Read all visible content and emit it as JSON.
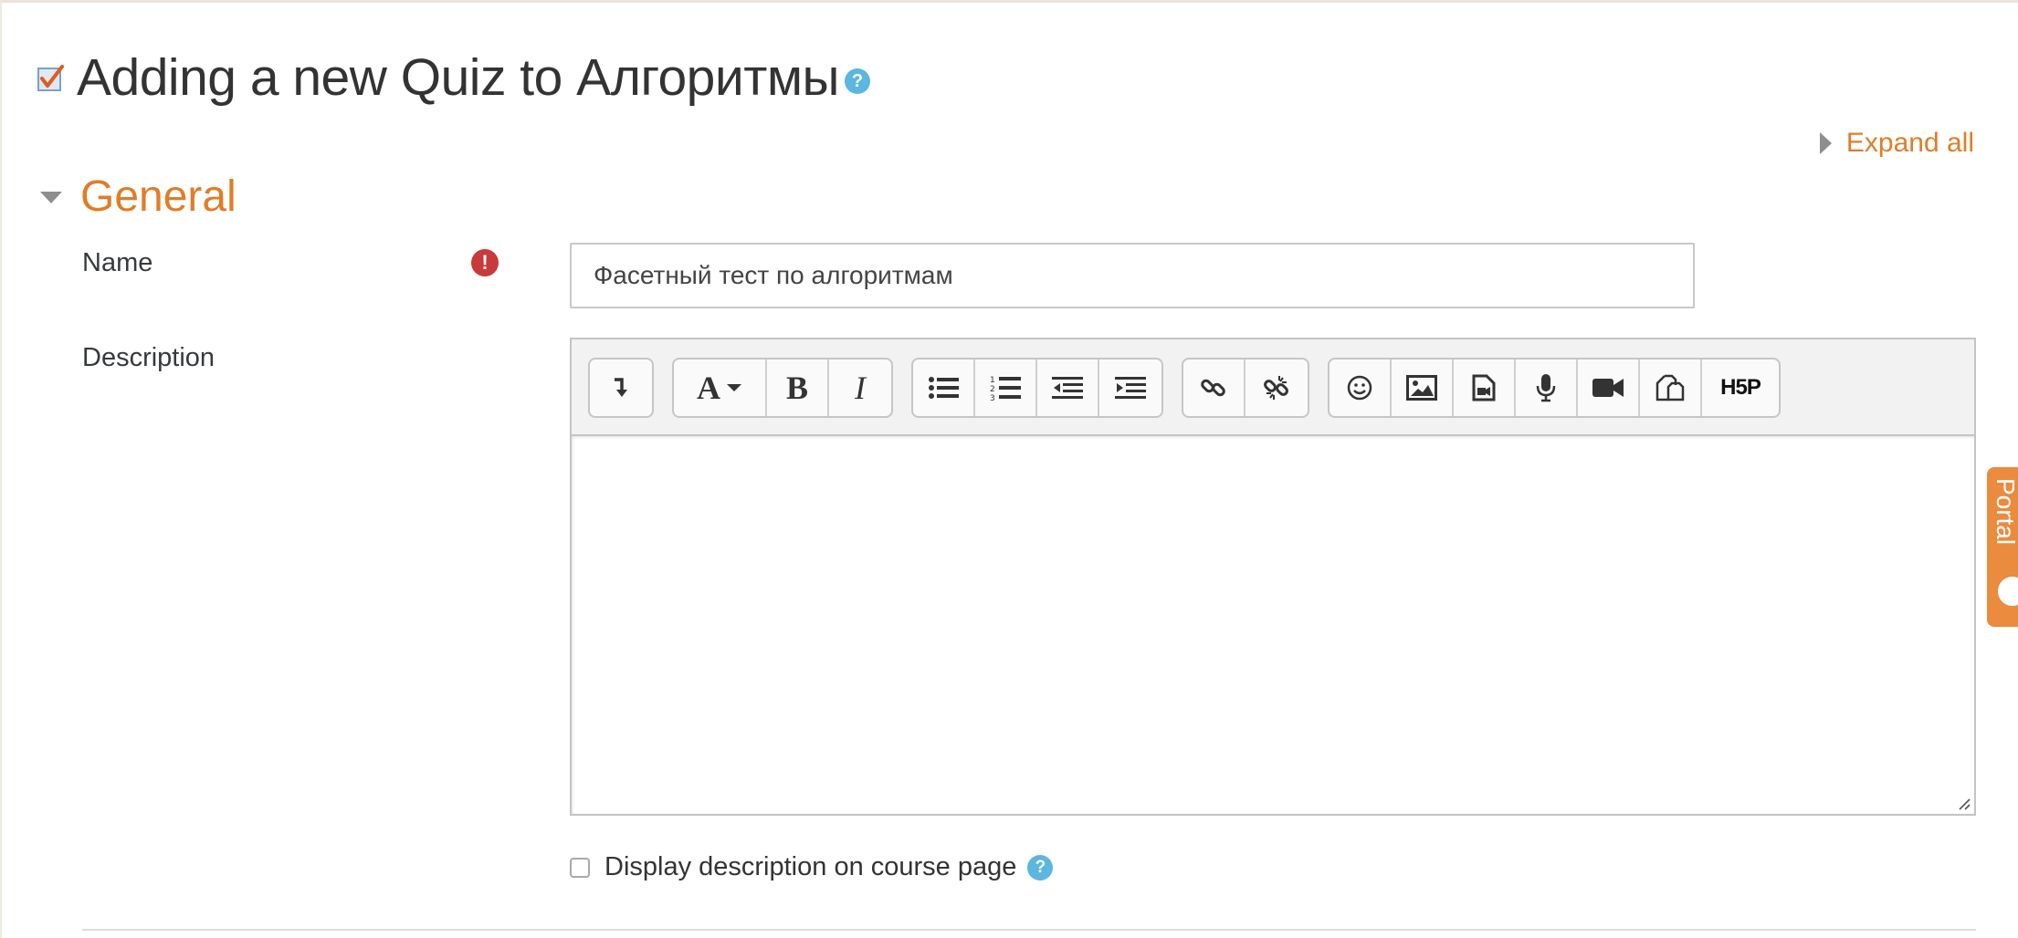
{
  "header": {
    "title": "Adding a new Quiz to Алгоритмы",
    "help_icon": "?"
  },
  "expand_all_label": "Expand all",
  "section": {
    "title": "General"
  },
  "form": {
    "name_label": "Name",
    "required_icon": "!",
    "name_value": "Фасетный тест по алгоритмам",
    "description_label": "Description",
    "display_description_label": "Display description on course page",
    "display_description_checked": false,
    "help_icon": "?"
  },
  "editor": {
    "content": "",
    "toolbar": [
      {
        "group": "show-more",
        "buttons": [
          "show-more-icon"
        ]
      },
      {
        "group": "style",
        "buttons": [
          "paragraph-style-icon",
          "bold-icon",
          "italic-icon"
        ],
        "labels": {
          "paragraph_style": "A",
          "bold": "B",
          "italic": "I"
        }
      },
      {
        "group": "list",
        "buttons": [
          "unordered-list-icon",
          "ordered-list-icon",
          "outdent-icon",
          "indent-icon"
        ]
      },
      {
        "group": "links",
        "buttons": [
          "link-icon",
          "unlink-icon"
        ]
      },
      {
        "group": "insert",
        "buttons": [
          "emoticon-icon",
          "image-icon",
          "media-icon",
          "record-audio-icon",
          "record-video-icon",
          "manage-files-icon",
          "h5p-icon"
        ],
        "labels": {
          "h5p": "H5P"
        }
      }
    ]
  },
  "side_tab": {
    "label": "Portal"
  },
  "colors": {
    "accent": "#e07d28",
    "help": "#5bb6e0",
    "required": "#ca3a3a",
    "portal_tab": "#eb8b3d"
  }
}
